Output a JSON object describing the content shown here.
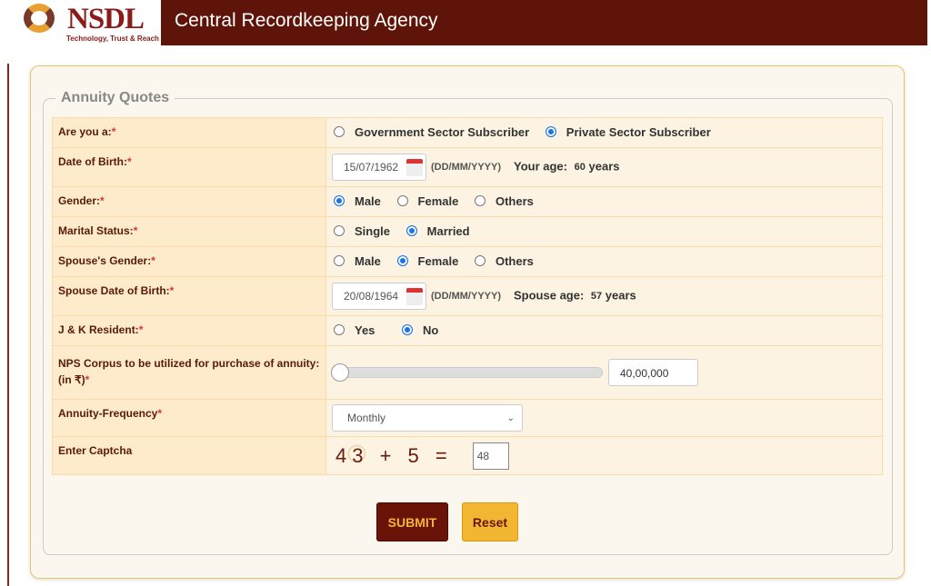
{
  "header": {
    "logo_text": "NSDL",
    "logo_tagline": "Technology, Trust & Reach",
    "title": "Central Recordkeeping Agency"
  },
  "form": {
    "legend": "Annuity Quotes",
    "subscriber": {
      "label": "Are you a:",
      "options": [
        "Government Sector Subscriber",
        "Private Sector Subscriber"
      ],
      "selected": "Private Sector Subscriber"
    },
    "dob": {
      "label": "Date of Birth:",
      "value": "15/07/1962",
      "format": "(DD/MM/YYYY)",
      "age_label": "Your age:",
      "age": "60",
      "age_unit": "years"
    },
    "gender": {
      "label": "Gender:",
      "options": [
        "Male",
        "Female",
        "Others"
      ],
      "selected": "Male"
    },
    "marital": {
      "label": "Marital Status:",
      "options": [
        "Single",
        "Married"
      ],
      "selected": "Married"
    },
    "spouse_gender": {
      "label": "Spouse's Gender:",
      "options": [
        "Male",
        "Female",
        "Others"
      ],
      "selected": "Female"
    },
    "spouse_dob": {
      "label": "Spouse Date of Birth:",
      "value": "20/08/1964",
      "format": "(DD/MM/YYYY)",
      "age_label": "Spouse age:",
      "age": "57",
      "age_unit": "years"
    },
    "jk": {
      "label": "J & K Resident:",
      "options": [
        "Yes",
        "No"
      ],
      "selected": "No"
    },
    "corpus": {
      "label": "NPS Corpus to be utilized for purchase of annuity: (in ₹)",
      "value": "40,00,000",
      "slider_fraction": 0
    },
    "frequency": {
      "label": "Annuity-Frequency",
      "value": "Monthly"
    },
    "captcha": {
      "label": "Enter Captcha",
      "expression": "43 + 5 =",
      "value": "48"
    },
    "required_mark": "*",
    "submit": "SUBMIT",
    "reset": "Reset"
  }
}
